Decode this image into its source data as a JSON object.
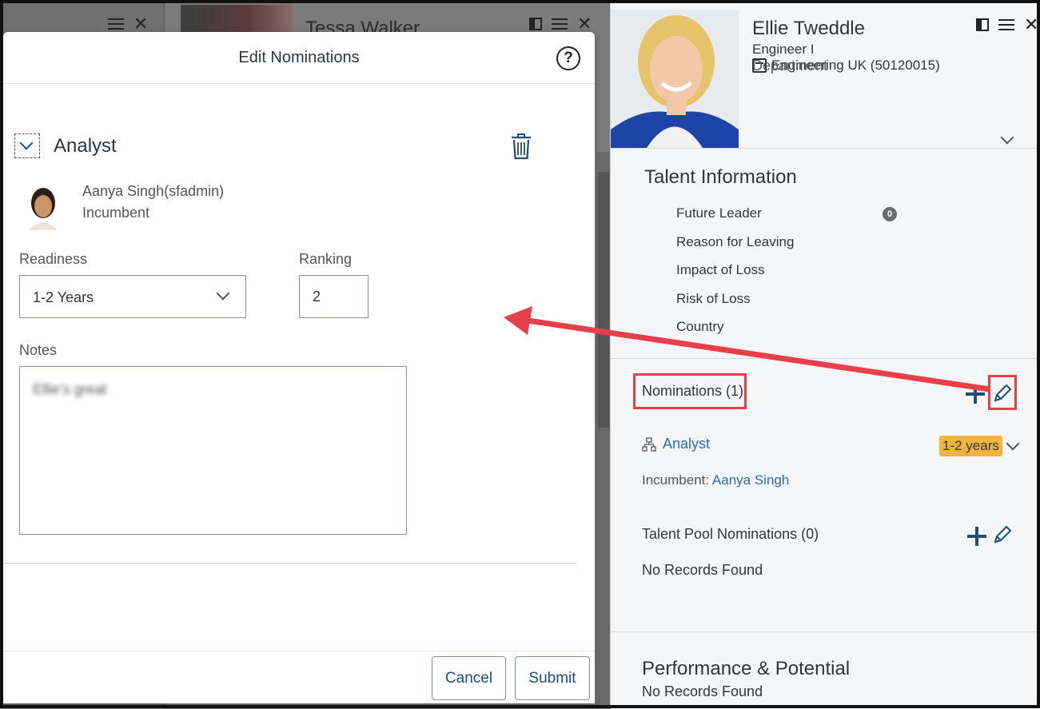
{
  "background": {
    "middle_card_name": "Tessa Walker"
  },
  "dialog": {
    "title": "Edit Nominations",
    "role": "Analyst",
    "incumbent_name": "Aanya Singh(sfadmin)",
    "incumbent_label": "Incumbent",
    "readiness_label": "Readiness",
    "readiness_value": "1-2 Years",
    "ranking_label": "Ranking",
    "ranking_value": "2",
    "notes_label": "Notes",
    "notes_value": "Ellie's great",
    "cancel_label": "Cancel",
    "submit_label": "Submit"
  },
  "profile": {
    "name": "Ellie Tweddle",
    "job_title": "Engineer I",
    "department_label": "Department",
    "department_value": "Engineering UK (50120015)",
    "talent_title": "Talent Information",
    "talent_items": [
      "Future Leader",
      "Reason for Leaving",
      "Impact of Loss",
      "Risk of Loss",
      "Country"
    ],
    "future_leader_badge": "0",
    "nominations_title": "Nominations (1)",
    "nomination_role": "Analyst",
    "nomination_readiness": "1-2 years",
    "incumbent_label": "Incumbent:",
    "incumbent_name": "Aanya Singh",
    "talent_pool_title": "Talent Pool Nominations (0)",
    "talent_pool_empty": "No Records Found",
    "performance_title": "Performance & Potential",
    "performance_empty": "No Records Found"
  },
  "colors": {
    "accent": "#1f4e79",
    "link": "#2a6bb5",
    "annotation_red": "#e8404a",
    "badge_orange": "#f0b33b"
  }
}
